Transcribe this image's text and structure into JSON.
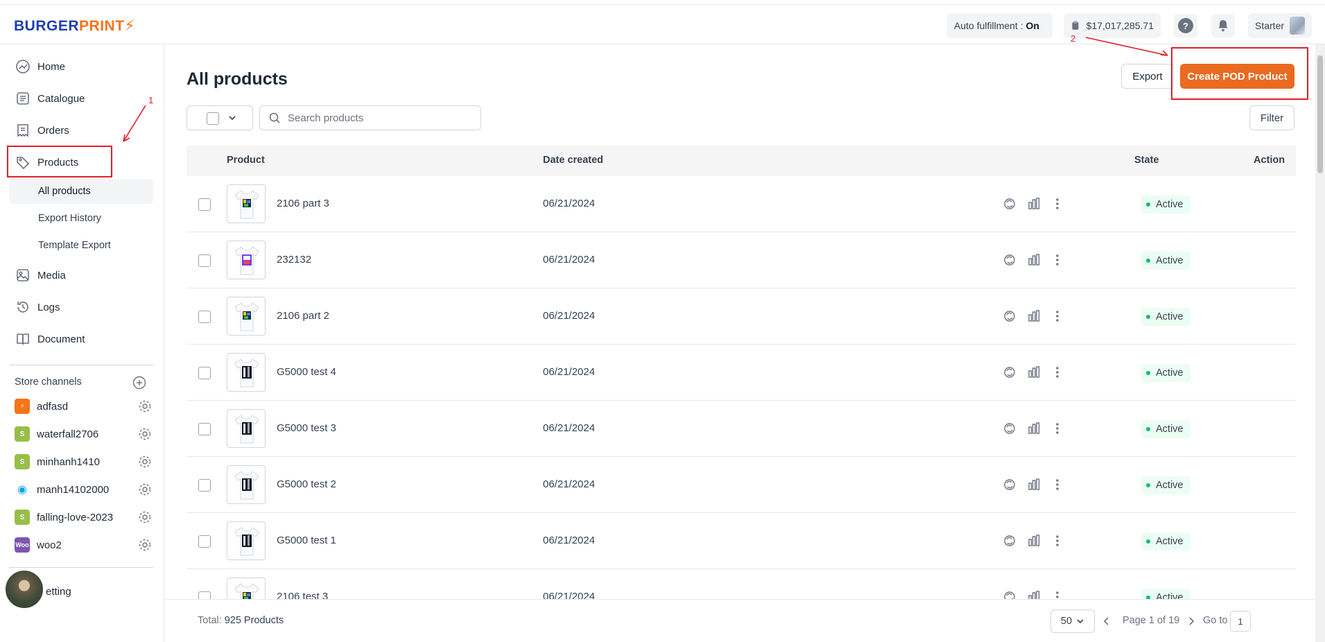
{
  "brand": {
    "part1": "BURGER",
    "part2": "PRINT"
  },
  "header": {
    "auto_label": "Auto fulfillment : ",
    "auto_value": "On",
    "balance": "$17,017,285.71",
    "help": "?",
    "plan": "Starter"
  },
  "sidebar": {
    "items": [
      {
        "label": "Home",
        "icon": "chart-line-icon"
      },
      {
        "label": "Catalogue",
        "icon": "catalogue-icon"
      },
      {
        "label": "Orders",
        "icon": "receipt-icon"
      },
      {
        "label": "Products",
        "icon": "tag-icon"
      }
    ],
    "subitems": [
      "All products",
      "Export History",
      "Template Export"
    ],
    "items2": [
      {
        "label": "Media",
        "icon": "image-icon"
      },
      {
        "label": "Logs",
        "icon": "history-icon"
      },
      {
        "label": "Document",
        "icon": "book-icon"
      }
    ],
    "channels_title": "Store channels",
    "channels": [
      {
        "name": "adfasd",
        "type": "burgerprints",
        "color": "#f97316"
      },
      {
        "name": "waterfall2706",
        "type": "shopify",
        "color": "#95bf47"
      },
      {
        "name": "minhanh1410",
        "type": "shopify",
        "color": "#95bf47"
      },
      {
        "name": "manh14102000",
        "type": "wix",
        "color": "#0ea5e9"
      },
      {
        "name": "falling-love-2023",
        "type": "shopify",
        "color": "#95bf47"
      },
      {
        "name": "woo2",
        "type": "woocommerce",
        "color": "#7f54b3"
      }
    ],
    "setting_label": "etting",
    "woo_text": "Woo"
  },
  "main": {
    "title": "All products",
    "export_label": "Export",
    "create_label": "Create POD Product",
    "search_placeholder": "Search products",
    "filter_label": "Filter",
    "columns": {
      "product": "Product",
      "date": "Date created",
      "state": "State",
      "action": "Action"
    },
    "rows": [
      {
        "name": "2106 part 3",
        "date": "06/21/2024",
        "state": "Active",
        "design": "color"
      },
      {
        "name": "232132",
        "date": "06/21/2024",
        "state": "Active",
        "design": "photo"
      },
      {
        "name": "2106 part 2",
        "date": "06/21/2024",
        "state": "Active",
        "design": "color"
      },
      {
        "name": "G5000 test 4",
        "date": "06/21/2024",
        "state": "Active",
        "design": "bw"
      },
      {
        "name": "G5000 test 3",
        "date": "06/21/2024",
        "state": "Active",
        "design": "bw"
      },
      {
        "name": "G5000 test 2",
        "date": "06/21/2024",
        "state": "Active",
        "design": "bw"
      },
      {
        "name": "G5000 test 1",
        "date": "06/21/2024",
        "state": "Active",
        "design": "bw"
      },
      {
        "name": "2106 test 3",
        "date": "06/21/2024",
        "state": "Active",
        "design": "color"
      }
    ]
  },
  "footer": {
    "total_label": "Total: ",
    "total_value": "925 Products",
    "per_page": "50",
    "page_info": "Page 1 of 19",
    "goto_label": "Go to",
    "goto_value": "1"
  },
  "annotations": {
    "one": "1",
    "two": "2"
  }
}
